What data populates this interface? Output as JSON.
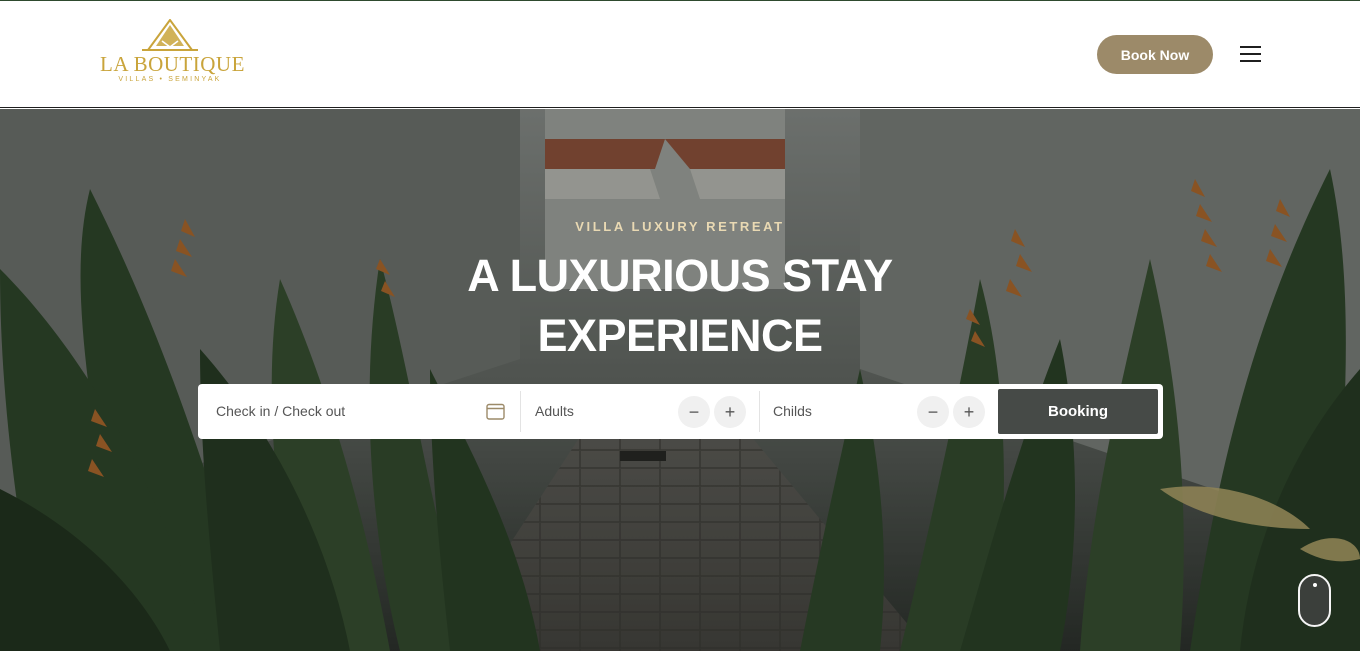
{
  "brand": {
    "name": "LA BOUTIQUE",
    "tagline": "VILLAS • SEMINYAK",
    "color": "#c9a43b"
  },
  "header": {
    "book_now_label": "Book Now",
    "book_now_color": "#9c8a69",
    "menu_icon": "hamburger-menu-icon"
  },
  "hero": {
    "eyebrow": "VILLA LUXURY RETREAT",
    "headline_line1": "A LUXURIOUS STAY",
    "headline_line2": "EXPERIENCE"
  },
  "booking_bar": {
    "dates_placeholder": "Check in / Check out",
    "dates_icon": "calendar-icon",
    "adults_label": "Adults",
    "childs_label": "Childs",
    "minus_symbol": "−",
    "plus_symbol": "+",
    "booking_label": "Booking",
    "booking_color": "#464a47"
  },
  "scroll_icon": "mouse-scroll-icon"
}
